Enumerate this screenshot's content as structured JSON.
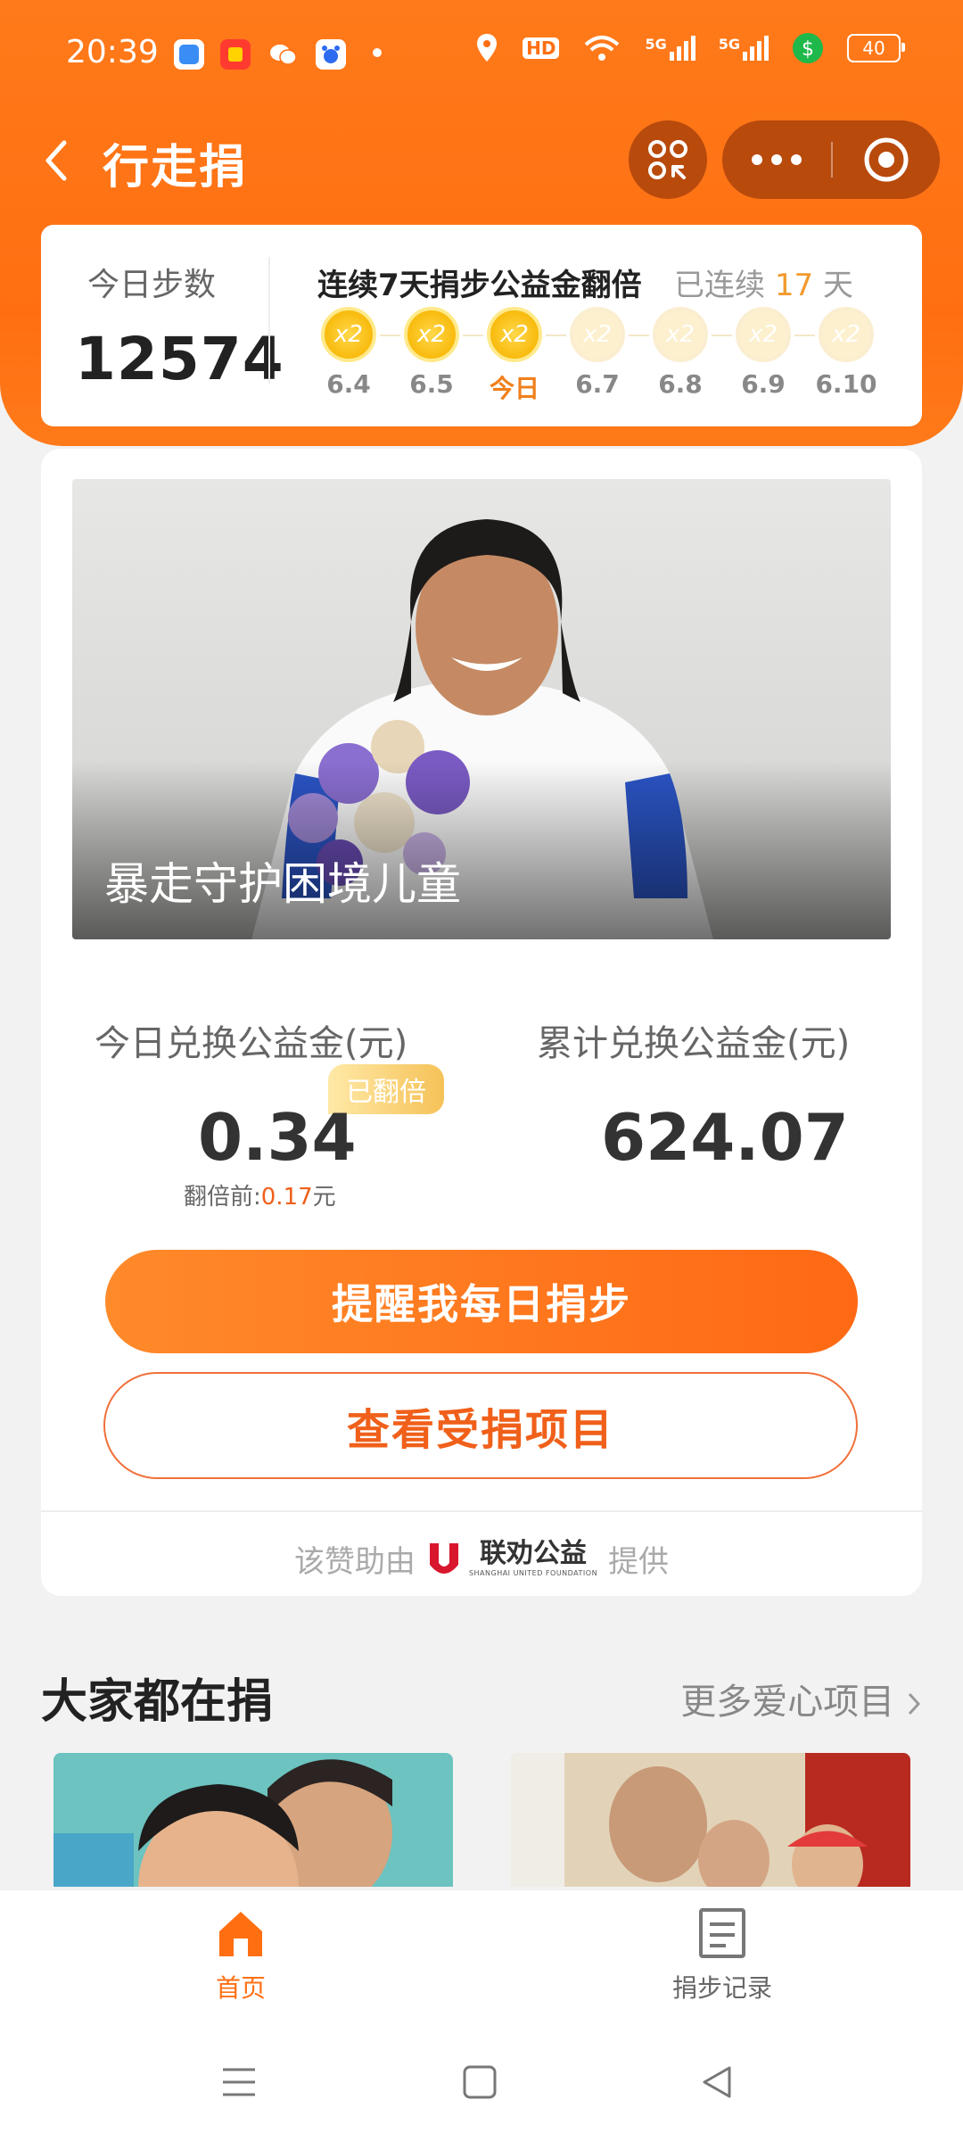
{
  "status_bar": {
    "time": "20:39",
    "battery": "40",
    "hd": "HD",
    "signal_a": "5G",
    "signal_b": "5G"
  },
  "header": {
    "title": "行走捐"
  },
  "steps": {
    "today_label": "今日步数",
    "today_value": "12574",
    "streak_title": "连续7天捐步公益金翻倍",
    "streak_prefix": "已连续",
    "streak_days": "17",
    "streak_suffix": "天",
    "coin_text": "x2",
    "days": [
      {
        "label": "6.4",
        "active": true
      },
      {
        "label": "6.5",
        "active": true
      },
      {
        "label": "今日",
        "active": true
      },
      {
        "label": "6.7",
        "active": false
      },
      {
        "label": "6.8",
        "active": false
      },
      {
        "label": "6.9",
        "active": false
      },
      {
        "label": "6.10",
        "active": false
      }
    ]
  },
  "hero": {
    "title": "暴走守护困境儿童"
  },
  "stats": {
    "today_label": "今日兑换公益金(元)",
    "today_value": "0.34",
    "badge": "已翻倍",
    "before_label": "翻倍前:",
    "before_value": "0.17",
    "before_unit": "元",
    "total_label": "累计兑换公益金(元)",
    "total_value": "624.07"
  },
  "buttons": {
    "remind": "提醒我每日捐步",
    "view_project": "查看受捐项目"
  },
  "sponsor": {
    "prefix": "该赞助由",
    "logo_cn": "联劝公益",
    "logo_en": "SHANGHAI UNITED FOUNDATION",
    "suffix": "提供"
  },
  "section": {
    "title": "大家都在捐",
    "more": "更多爱心项目"
  },
  "tabbar": {
    "home": "首页",
    "records": "捐步记录"
  },
  "colors": {
    "brand_orange": "#ff6f12",
    "accent_gold": "#f7b400",
    "dark_capsule": "#b84a0c"
  }
}
